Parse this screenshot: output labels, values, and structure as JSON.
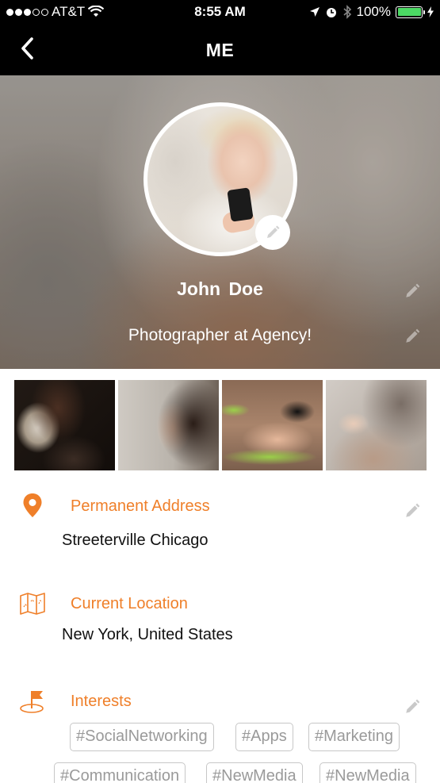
{
  "status_bar": {
    "carrier": "AT&T",
    "time": "8:55 AM",
    "battery": "100%",
    "battery_color": "#4cd964"
  },
  "nav": {
    "title": "ME",
    "back_icon": "chevron-left-icon"
  },
  "profile": {
    "name": "John  Doe",
    "title": "Photographer at Agency!",
    "edit_icon": "pencil-icon"
  },
  "photos": [
    {
      "label": "photo-1"
    },
    {
      "label": "photo-2"
    },
    {
      "label": "photo-3"
    },
    {
      "label": "photo-4"
    }
  ],
  "sections": {
    "permanent_address": {
      "label": "Permanent Address",
      "value": "Streeterville Chicago",
      "icon": "location-pin-icon"
    },
    "current_location": {
      "label": "Current Location",
      "value": "New York, United States",
      "icon": "map-icon"
    },
    "interests": {
      "label": "Interests",
      "icon": "flag-icon",
      "tags": [
        "#SocialNetworking",
        "#Apps",
        "#Marketing",
        "#Communication",
        "#NewMedia",
        "#NewMedia"
      ]
    }
  },
  "colors": {
    "accent": "#ef7f29",
    "tag_border": "#c7c7c7",
    "tag_text": "#9a9a9a"
  }
}
